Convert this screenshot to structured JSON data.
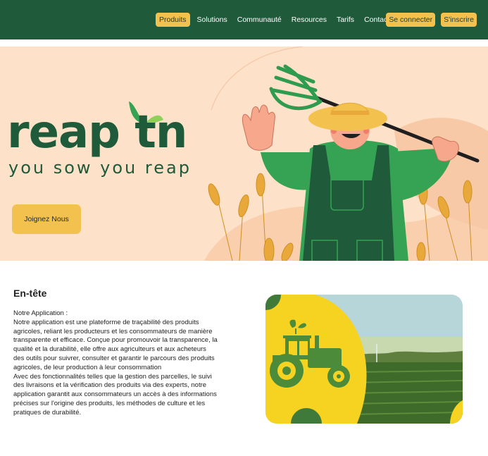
{
  "nav": {
    "items": [
      {
        "label": "Produits",
        "active": true
      },
      {
        "label": "Solutions"
      },
      {
        "label": "Communauté"
      },
      {
        "label": "Resources"
      },
      {
        "label": "Tarifs"
      },
      {
        "label": "Contact"
      }
    ],
    "login_label": "Se connecter",
    "signup_label": "S'inscrire"
  },
  "hero": {
    "brand": "reap tn",
    "tagline": "you sow you reap",
    "cta_label": "Joignez Nous"
  },
  "content": {
    "title": "En-tête",
    "paragraph": "Notre Application :\nNotre application est une plateforme  de traçabilité des produits agricoles, reliant les producteurs et les consommateurs de manière transparente et efficace. Conçue pour promouvoir la transparence, la qualité et la durabilité, elle offre aux agriculteurs et aux acheteurs des outils pour suivrer, consulter et garantir le parcours des produits agricoles, de leur production à leur consommation\nAvec des fonctionnalités telles que la gestion des parcelles, le suivi des livraisons et la vérification des produits via des experts, notre application garantit aux consommateurs un accès à des informations précises sur l'origine des produits, les méthodes de culture et les pratiques de durabilité."
  },
  "colors": {
    "header_bg": "#1f5a3a",
    "accent": "#f2c14e",
    "hero_bg": "#fde1c8",
    "brand_green": "#1f5a3a"
  }
}
